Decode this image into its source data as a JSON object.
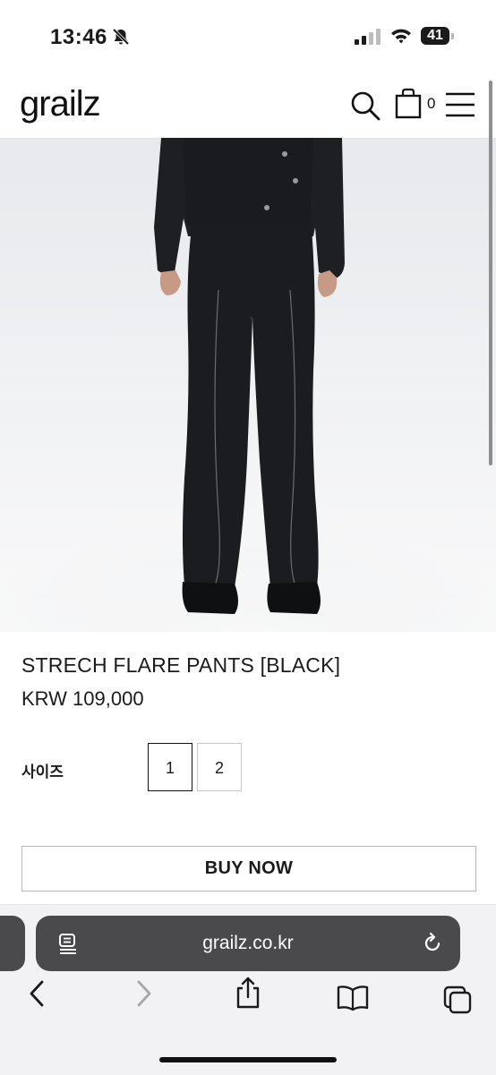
{
  "status_bar": {
    "time": "13:46",
    "battery": "41"
  },
  "header": {
    "logo": "grailz",
    "cart_count": "0"
  },
  "product": {
    "title": "STRECH FLARE PANTS [BLACK]",
    "price": "KRW 109,000",
    "size_label": "사이즈",
    "sizes": [
      "1",
      "2"
    ],
    "selected_size": "1",
    "buy_label": "BUY NOW"
  },
  "browser": {
    "url": "grailz.co.kr"
  },
  "icons": {
    "status": [
      "bell-slash-icon",
      "cellular-signal-icon",
      "wifi-icon",
      "battery-icon"
    ],
    "header": [
      "search-icon",
      "shopping-bag-icon",
      "hamburger-menu-icon"
    ],
    "browser": [
      "reader-mode-icon",
      "reload-icon",
      "back-icon",
      "forward-icon",
      "share-icon",
      "bookmarks-icon",
      "tabs-icon"
    ]
  },
  "colors": {
    "address_bar": "#4a4a4c",
    "toolbar_bg": "#f2f2f4",
    "text": "#1b1b1b"
  }
}
